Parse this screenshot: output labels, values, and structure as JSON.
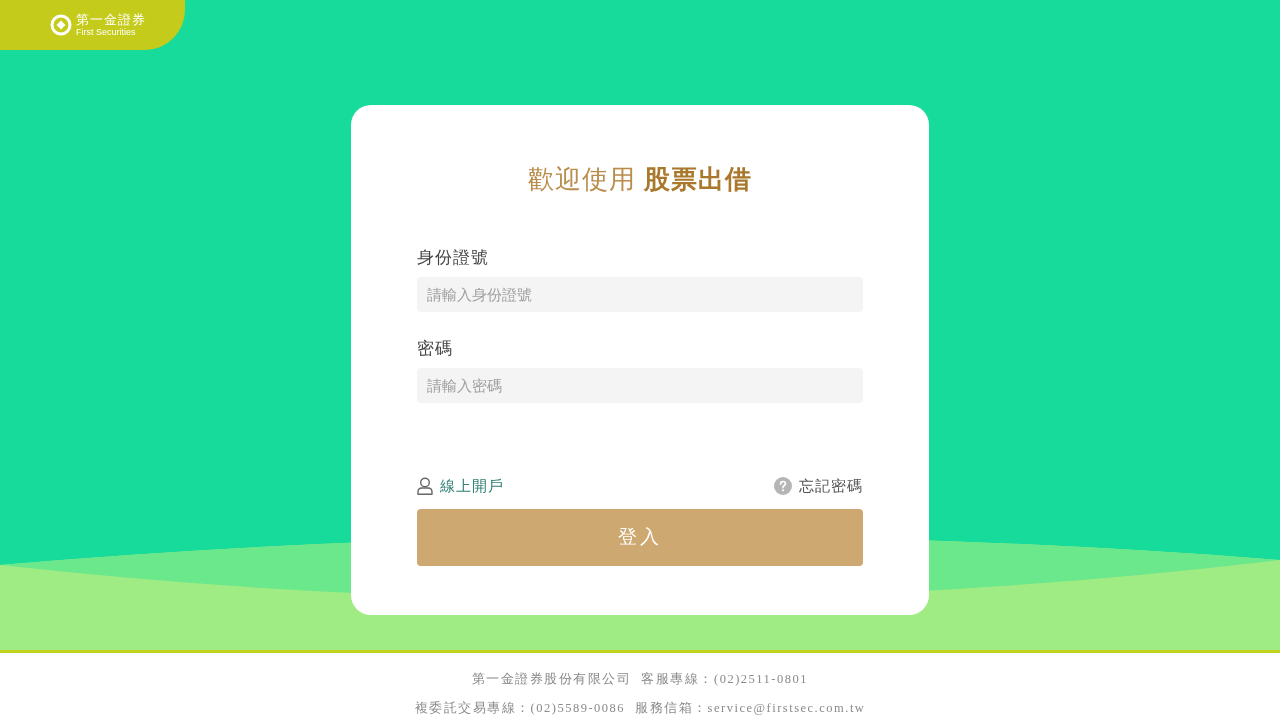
{
  "logo": {
    "name": "第一金證券",
    "subtitle": "First Securities"
  },
  "card": {
    "title": "歡迎使用 **股票出借**",
    "fields": [
      {
        "label": "身份證號",
        "placeholder": "請輸入身份證號"
      },
      {
        "label": "密碼",
        "placeholder": "請輸入密碼"
      }
    ],
    "links": [
      {
        "kind": "signup",
        "label": "線上開戶"
      },
      {
        "kind": "help",
        "label": "忘記密碼"
      }
    ],
    "submit": "登入"
  },
  "footer": {
    "lines": [
      [
        "第一金證券股份有限公司",
        "客服專線：(02)2511-0801"
      ],
      [
        "複委託交易專線：(02)5589-0086",
        "服務信箱：service@firstsec.com.tw"
      ]
    ]
  }
}
